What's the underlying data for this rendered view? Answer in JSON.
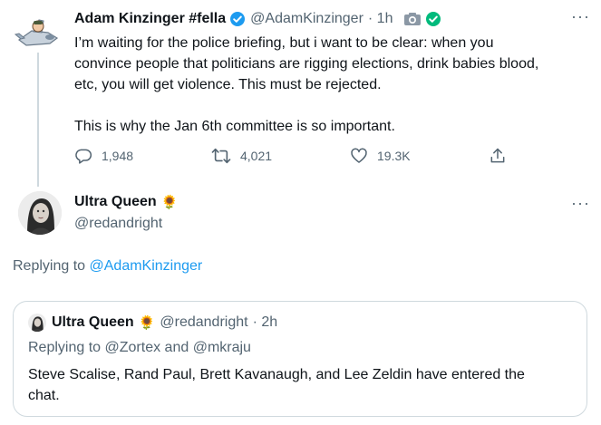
{
  "colors": {
    "link": "#1d9bf0",
    "muted": "#536471",
    "text": "#0f1419",
    "verified": "#1d9bf0",
    "affiliate": "#00ba7c"
  },
  "tweet1": {
    "display_name": "Adam Kinzinger #fella",
    "handle": "@AdamKinzinger",
    "time": "· 1h",
    "more": "···",
    "text_line1": "I’m waiting for the police briefing, but i want to be clear:  when you",
    "text_line2": "convince people that politicians are rigging elections, drink babies blood,",
    "text_line3": "etc, you will get violence.  This must be rejected.",
    "text_line4": "This is why the Jan 6th committee is so important.",
    "replies": "1,948",
    "retweets": "4,021",
    "likes": "19.3K",
    "icons": [
      "verified-badge-icon",
      "camera-icon",
      "affiliate-check-icon",
      "reply-icon",
      "retweet-icon",
      "like-icon",
      "share-icon"
    ]
  },
  "tweet2": {
    "display_name": "Ultra Queen",
    "emoji": "🌻",
    "handle": "@redandright",
    "more": "···",
    "replying_label": "Replying to",
    "replying_handle": "@AdamKinzinger"
  },
  "quote": {
    "display_name": "Ultra Queen",
    "emoji": "🌻",
    "handle": "@redandright",
    "time": "· 2h",
    "replying_label": "Replying to",
    "replying_handle1": "@Zortex",
    "replying_and": "and",
    "replying_handle2": "@mkraju",
    "text_line1": "Steve Scalise, Rand Paul, Brett Kavanaugh, and Lee Zeldin have entered the",
    "text_line2": "chat."
  }
}
